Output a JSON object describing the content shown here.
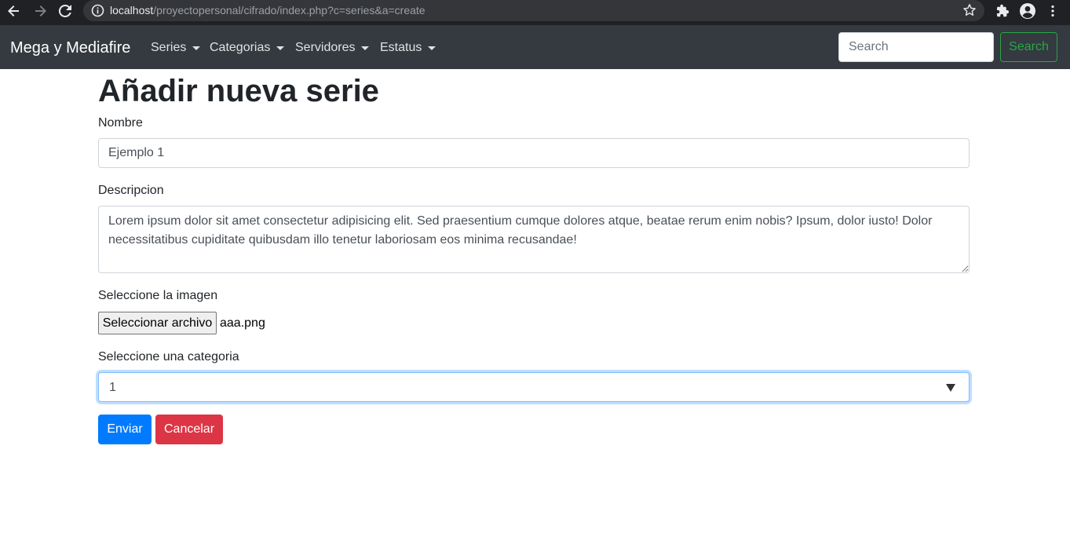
{
  "browser": {
    "url_host": "localhost",
    "url_path": "/proyectopersonal/cifrado/index.php?c=series&a=create",
    "icons": [
      "back-arrow-icon",
      "forward-arrow-icon",
      "reload-icon",
      "info-icon",
      "star-icon",
      "extensions-icon",
      "profile-icon",
      "menu-dots-icon"
    ]
  },
  "navbar": {
    "brand": "Mega y Mediafire",
    "items": [
      {
        "label": "Series"
      },
      {
        "label": "Categorias"
      },
      {
        "label": "Servidores"
      },
      {
        "label": "Estatus"
      }
    ],
    "search_placeholder": "Search",
    "search_button": "Search"
  },
  "form": {
    "title": "Añadir nueva serie",
    "nombre_label": "Nombre",
    "nombre_value": "Ejemplo 1",
    "descripcion_label": "Descripcion",
    "descripcion_value": "Lorem ipsum dolor sit amet consectetur adipisicing elit. Sed praesentium cumque dolores atque, beatae rerum enim nobis? Ipsum, dolor iusto! Dolor necessitatibus cupiditate quibusdam illo tenetur laboriosam eos minima recusandae!",
    "imagen_label": "Seleccione la imagen",
    "file_button": "Seleccionar archivo",
    "file_name": "aaa.png",
    "categoria_label": "Seleccione una categoria",
    "categoria_value": "1",
    "submit_label": "Enviar",
    "cancel_label": "Cancelar"
  },
  "colors": {
    "navbar_bg": "#343a40",
    "primary": "#007bff",
    "danger": "#dc3545",
    "success": "#28a745"
  }
}
